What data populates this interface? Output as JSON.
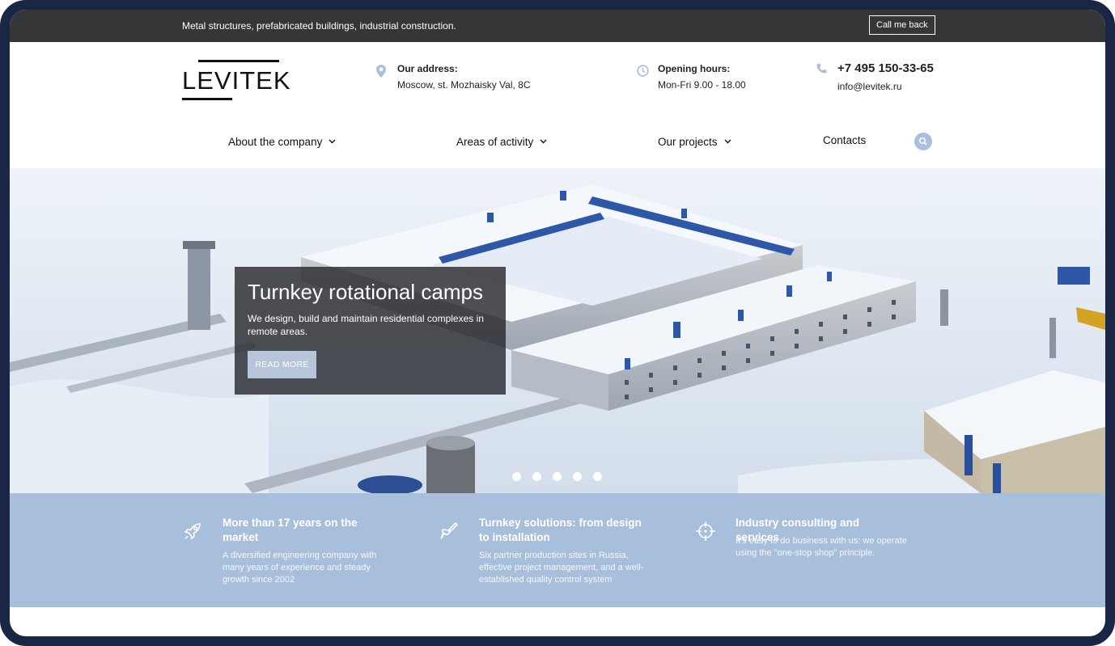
{
  "topbar": {
    "tagline": "Metal structures, prefabricated buildings, industrial construction.",
    "call_button": "Call me back"
  },
  "header": {
    "logo_text": "LEVITEK",
    "address": {
      "label": "Our address:",
      "value": "Moscow, st. Mozhaisky Val, 8C",
      "icon": "location-pin-icon"
    },
    "hours": {
      "label": "Opening hours:",
      "value": "Mon-Fri 9.00 - 18.00",
      "icon": "clock-icon"
    },
    "contact": {
      "phone": "+7 495 150-33-65",
      "email": "info@levitek.ru",
      "icon": "phone-icon"
    }
  },
  "nav": {
    "items": [
      {
        "label": "About the company",
        "has_dropdown": true
      },
      {
        "label": "Areas of activity",
        "has_dropdown": true
      },
      {
        "label": "Our projects",
        "has_dropdown": true
      },
      {
        "label": "Contacts",
        "has_dropdown": false
      }
    ],
    "search_icon": "search-icon"
  },
  "hero": {
    "title": "Turnkey rotational camps",
    "description": "We design, build and maintain residential complexes in remote areas.",
    "button": "READ MORE",
    "slide_count": 5
  },
  "features": [
    {
      "icon": "rocket-icon",
      "title": "More than 17 years on the market",
      "description": "A diversified engineering company with many years of experience and steady growth since 2002"
    },
    {
      "icon": "brush-icon",
      "title": "Turnkey solutions: from design to installation",
      "description": "Six partner production sites in Russia, effective project management, and a well-established quality control system"
    },
    {
      "icon": "crosshair-icon",
      "title": "Industry consulting and services",
      "description": "It's easy to do business with us: we operate using the \"one-stop shop\" principle."
    }
  ],
  "colors": {
    "topbar_bg": "#353638",
    "accent_blue": "#a8bfdc",
    "frame": "#1b2545"
  }
}
